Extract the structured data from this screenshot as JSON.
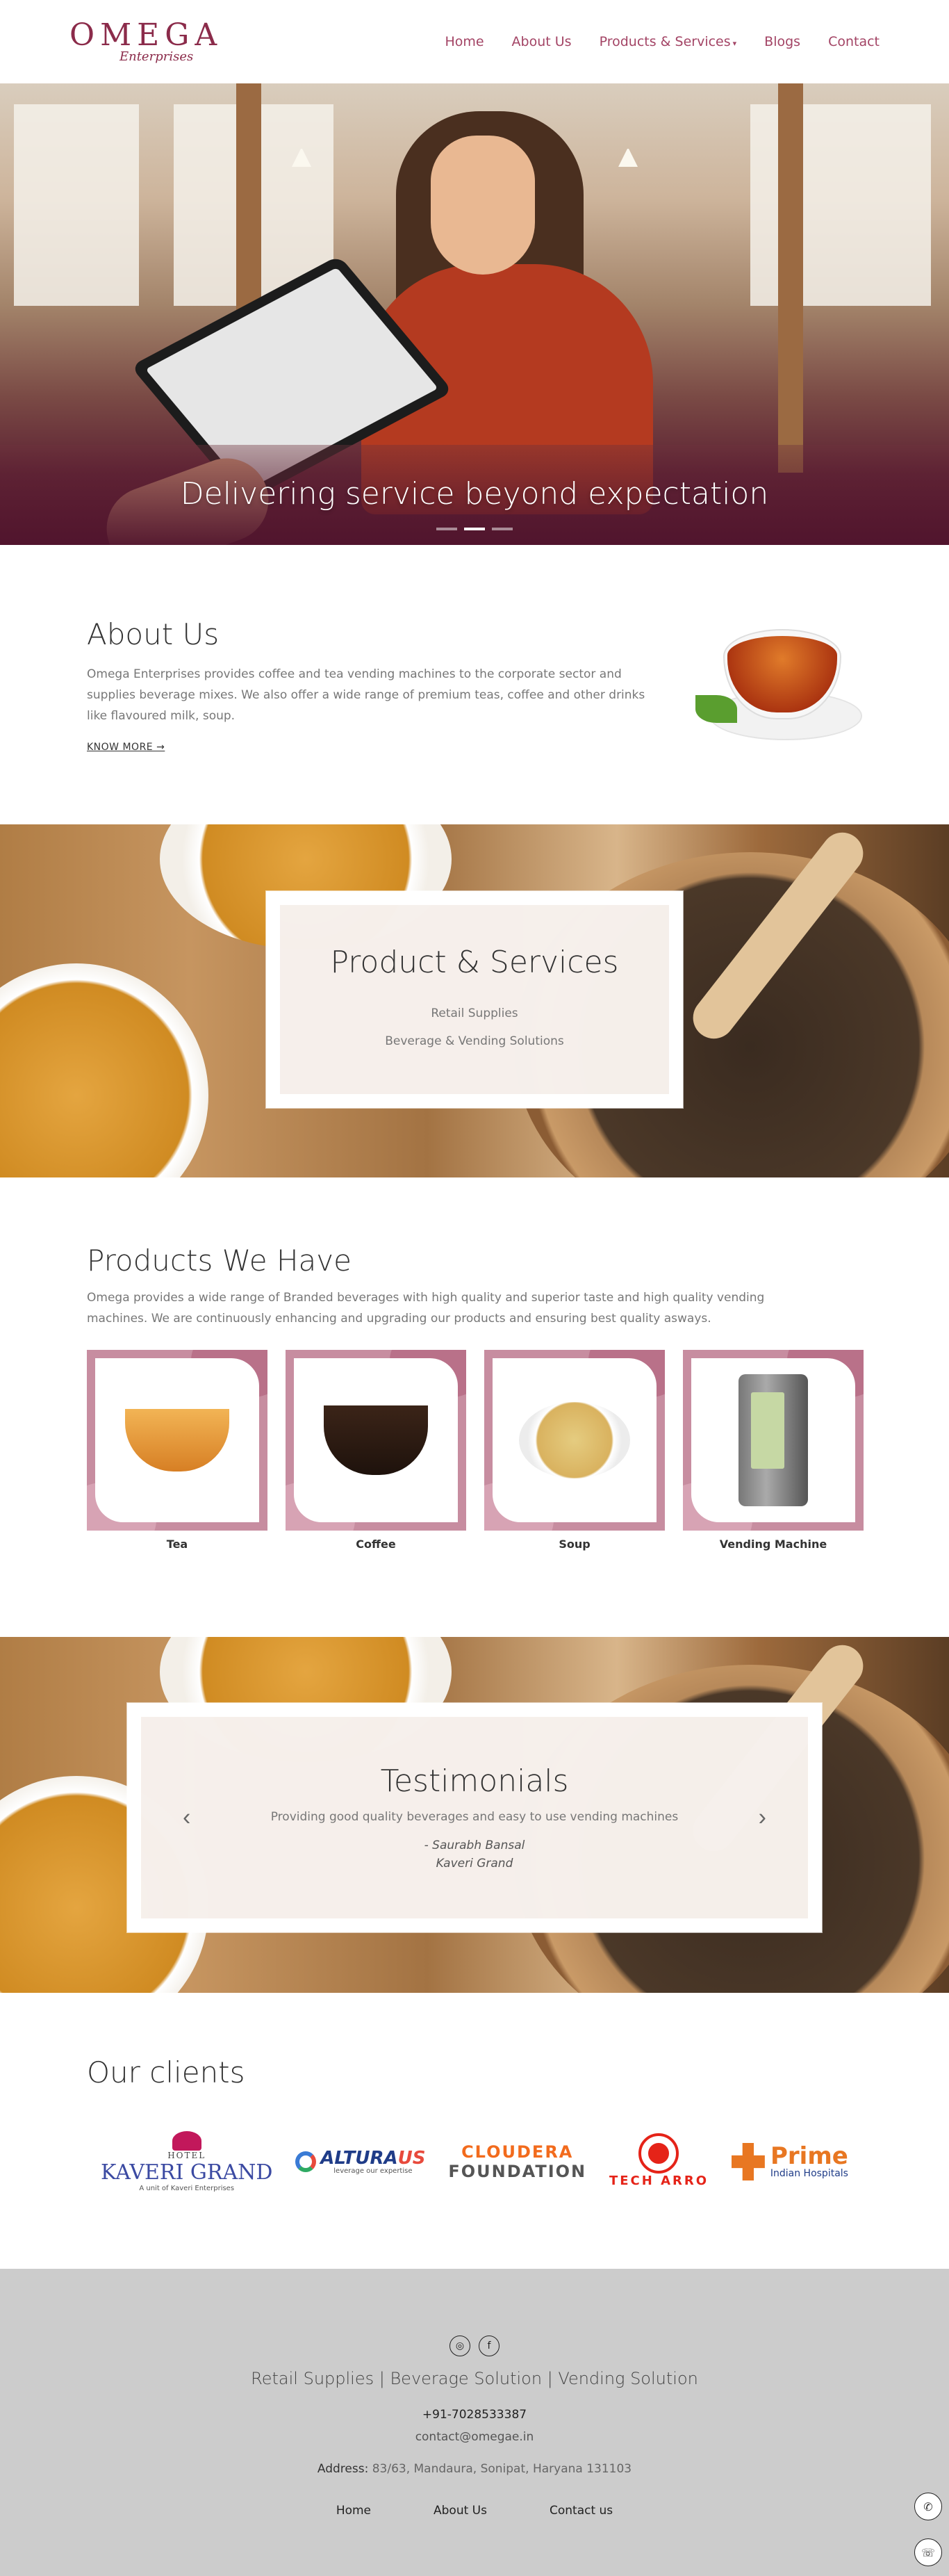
{
  "nav": {
    "logo_main": "OMEGA",
    "logo_sub": "Enterprises",
    "items": [
      {
        "label": "Home"
      },
      {
        "label": "About Us"
      },
      {
        "label": "Products & Services",
        "caret": "▾"
      },
      {
        "label": "Blogs"
      },
      {
        "label": "Contact"
      }
    ]
  },
  "hero": {
    "caption": "Delivering service beyond expectation",
    "slides": 3,
    "active_slide": 2
  },
  "about": {
    "title": "About Us",
    "text": "Omega Enterprises provides coffee and tea vending machines to the corporate sector and supplies beverage mixes. We also offer a wide range of premium teas, coffee and other drinks like flavoured milk, soup.",
    "link": "KNOW MORE →"
  },
  "product_services": {
    "title": "Product & Services",
    "items": [
      "Retail Supplies",
      "Beverage & Vending Solutions"
    ]
  },
  "products": {
    "title": "Products We Have",
    "description": "Omega provides a wide range of Branded beverages with high quality and superior taste and high quality vending machines. We are continuously enhancing and upgrading our products and ensuring best quality asways.",
    "cards": [
      {
        "label": "Tea",
        "icon": "tea-cup-icon"
      },
      {
        "label": "Coffee",
        "icon": "coffee-cup-icon"
      },
      {
        "label": "Soup",
        "icon": "soup-bowl-icon"
      },
      {
        "label": "Vending Machine",
        "icon": "vending-machine-icon"
      }
    ]
  },
  "testimonials": {
    "title": "Testimonials",
    "quote": "Providing good quality beverages and easy to use vending machines",
    "author": "- Saurabh Bansal",
    "company": "Kaveri Grand",
    "prev": "‹",
    "next": "›"
  },
  "clients": {
    "title": "Our clients",
    "kaveri": {
      "hotel": "HOTEL",
      "name": "KAVERI GRAND",
      "tag": "A unit of Kaveri Enterprises"
    },
    "alturaus": {
      "name_a": "ALTURA",
      "name_b": "US",
      "tag": "leverage our expertise"
    },
    "cloudera": {
      "line1": "CLOUDERA",
      "line2": "FOUNDATION"
    },
    "techarro": {
      "name": "TECH ARRO"
    },
    "prime": {
      "name": "Prime",
      "tag": "Indian Hospitals"
    }
  },
  "footer": {
    "social": [
      {
        "icon": "instagram-icon",
        "glyph": "◎"
      },
      {
        "icon": "facebook-icon",
        "glyph": "f"
      }
    ],
    "services": "Retail Supplies | Beverage Solution | Vending Solution",
    "phone": "+91-7028533387",
    "email": "contact@omegae.in",
    "address_label": "Address:",
    "address": " 83/63, Mandaura, Sonipat, Haryana 131103",
    "links": [
      "Home",
      "About Us",
      "Contact us"
    ],
    "float_call": "✆",
    "float_whatsapp": "☏"
  },
  "colors": {
    "brand": "#a34465",
    "footer_bg": "#cccccc",
    "card_frame": "#c78da0"
  }
}
